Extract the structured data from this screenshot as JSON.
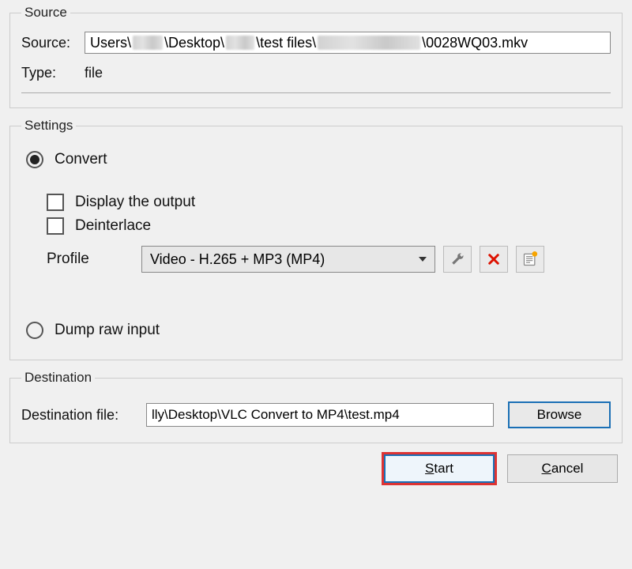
{
  "source": {
    "legend": "Source",
    "label": "Source:",
    "path_parts": {
      "p1": "Users\\",
      "p2": "\\Desktop\\",
      "p3": "\\test files\\",
      "p4": "\\0028WQ03.mkv"
    },
    "type_label": "Type:",
    "type_value": "file"
  },
  "settings": {
    "legend": "Settings",
    "convert": {
      "label": "Convert",
      "checked": true
    },
    "display_output": {
      "label": "Display the output",
      "checked": false
    },
    "deinterlace": {
      "label": "Deinterlace",
      "checked": false
    },
    "profile": {
      "label": "Profile",
      "value": "Video - H.265 + MP3 (MP4)",
      "icons": {
        "edit": "wrench-icon",
        "delete": "x-icon",
        "new": "new-profile-icon"
      }
    },
    "dump_raw": {
      "label": "Dump raw input",
      "checked": false
    }
  },
  "destination": {
    "legend": "Destination",
    "label": "Destination file:",
    "value": "lly\\Desktop\\VLC Convert to MP4\\test.mp4",
    "browse_label": "Browse"
  },
  "buttons": {
    "start": "Start",
    "cancel": "Cancel"
  }
}
